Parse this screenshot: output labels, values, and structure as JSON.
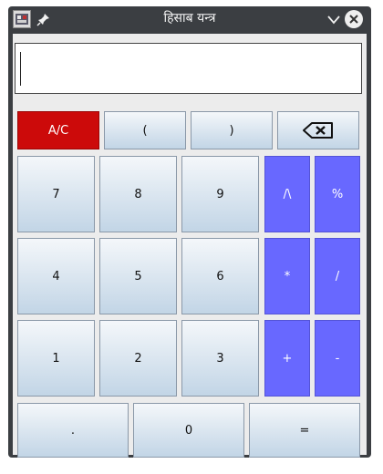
{
  "window": {
    "title": "हिसाब यन्त्र"
  },
  "display": {
    "value": ""
  },
  "colors": {
    "clear": "#cc0a0a",
    "operator": "#6868ff",
    "titlebar": "#3b3e42"
  },
  "icons": {
    "backspace": "backspace-icon",
    "minimize": "chevron-down-icon",
    "close": "close-icon",
    "pin": "pin-icon",
    "app": "app-icon"
  },
  "buttons": {
    "clear": "A/C",
    "open_paren": "(",
    "close_paren": ")",
    "seven": "7",
    "eight": "8",
    "nine": "9",
    "four": "4",
    "five": "5",
    "six": "6",
    "one": "1",
    "two": "2",
    "three": "3",
    "power": "/\\",
    "percent": "%",
    "multiply": "*",
    "divide": "/",
    "plus": "+",
    "minus": "-",
    "dot": ".",
    "zero": "0",
    "equals": "="
  }
}
